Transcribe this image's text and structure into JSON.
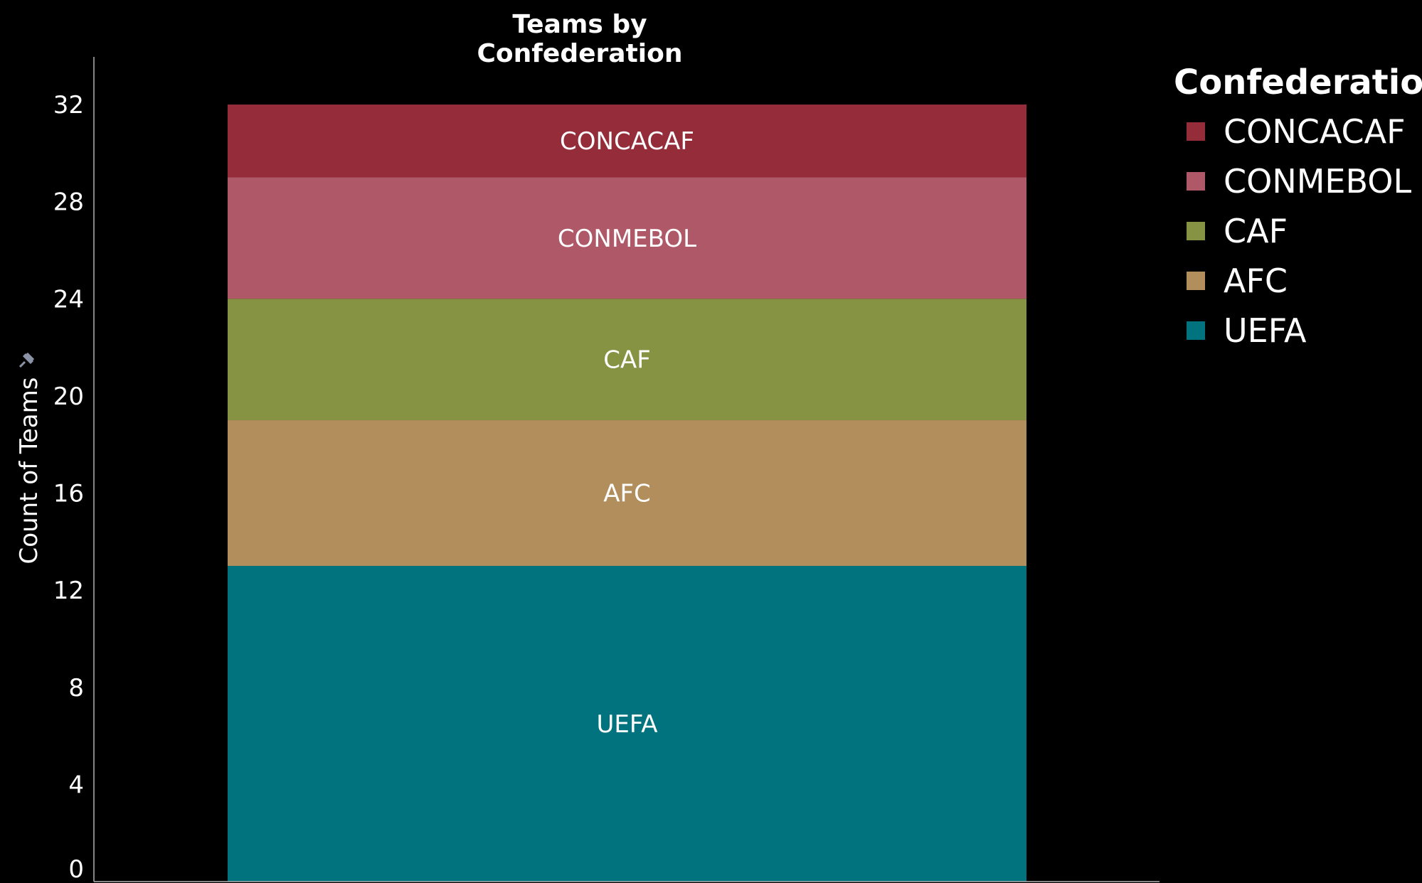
{
  "chart_data": {
    "type": "bar",
    "title": "Teams by Confederation",
    "xlabel": "",
    "ylabel": "Count of Teams",
    "ylim": [
      0,
      32
    ],
    "yticks": [
      0,
      4,
      8,
      12,
      16,
      20,
      24,
      28,
      32
    ],
    "stacked": true,
    "categories": [
      ""
    ],
    "legend": {
      "title": "Confederation",
      "position": "right"
    },
    "series": [
      {
        "name": "UEFA",
        "values": [
          13
        ],
        "color": "#00737f"
      },
      {
        "name": "AFC",
        "values": [
          6
        ],
        "color": "#b38e5d"
      },
      {
        "name": "CAF",
        "values": [
          5
        ],
        "color": "#869343"
      },
      {
        "name": "CONMEBOL",
        "values": [
          5
        ],
        "color": "#ae5868"
      },
      {
        "name": "CONCACAF",
        "values": [
          3
        ],
        "color": "#952c3a"
      }
    ],
    "legend_order": [
      "CONCACAF",
      "CONMEBOL",
      "CAF",
      "AFC",
      "UEFA"
    ],
    "axis_color": "#ffffff",
    "background": "#000000"
  }
}
